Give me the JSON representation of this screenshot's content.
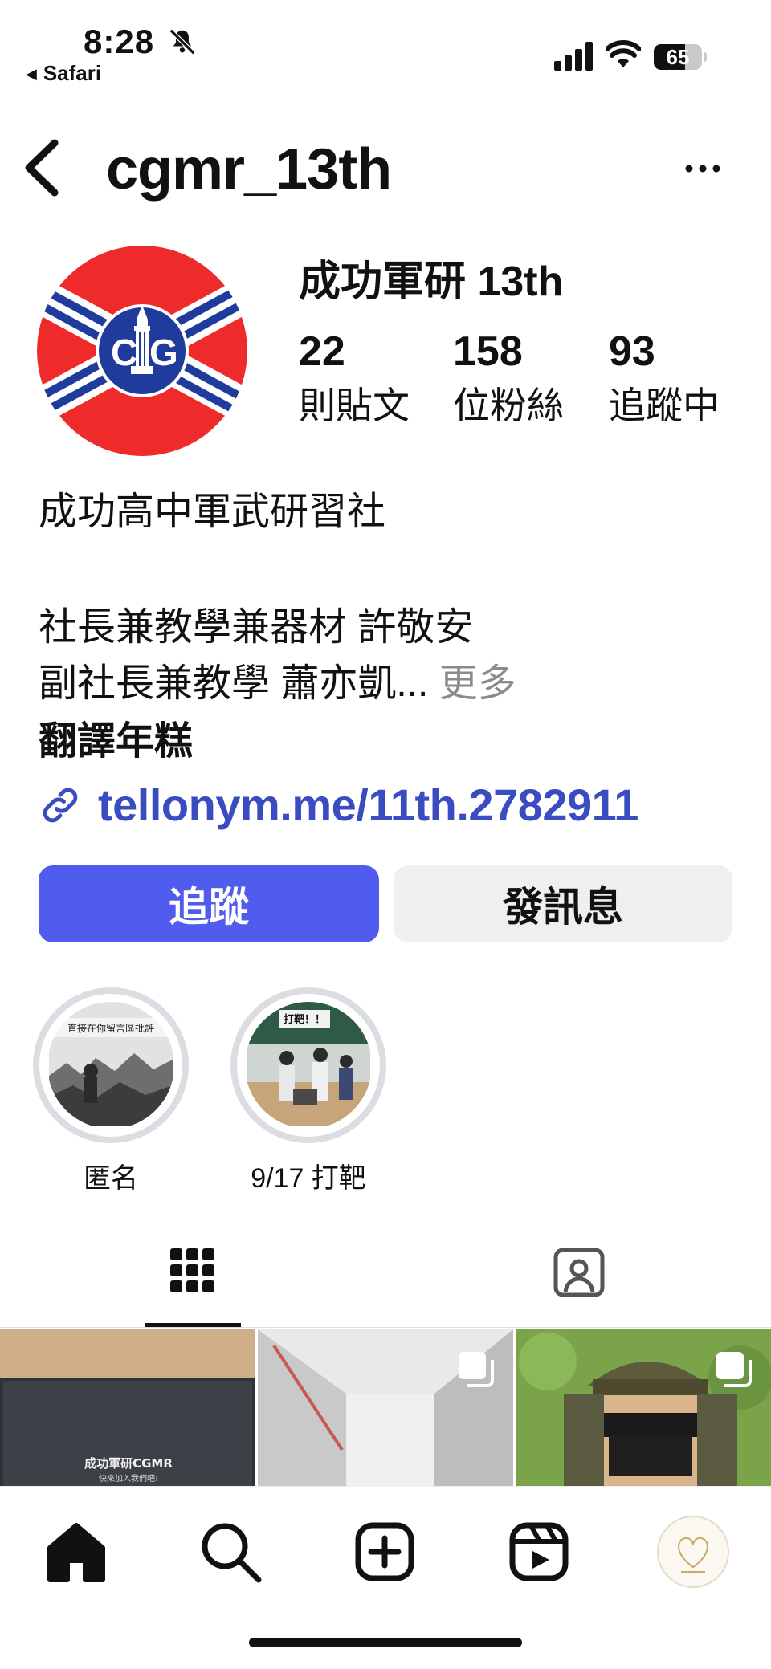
{
  "status_bar": {
    "time": "8:28",
    "back_app": "Safari",
    "battery": "65",
    "battery_level": 0.65
  },
  "header": {
    "username": "cgmr_13th"
  },
  "profile": {
    "avatar_text": "CG",
    "display_name": "成功軍研 13th",
    "stats": [
      {
        "value": "22",
        "label": "則貼文"
      },
      {
        "value": "158",
        "label": "位粉絲"
      },
      {
        "value": "93",
        "label": "追蹤中"
      }
    ],
    "bio": {
      "line1": "成功高中軍武研習社",
      "line2": "社長兼教學兼器材 許敬安",
      "line3": "副社長兼教學 蕭亦凱...",
      "more": " 更多",
      "translate": "翻譯年糕"
    },
    "link": "tellonym.me/11th.2782911"
  },
  "actions": {
    "follow": "追蹤",
    "message": "發訊息"
  },
  "highlights": [
    {
      "label": "匿名",
      "thumb_text": "直接在你留言區批評"
    },
    {
      "label": "9/17 打靶",
      "thumb_text": "打靶！！"
    }
  ],
  "posts": [
    {
      "text": "成功軍研CGMR",
      "subtext": "快來加入我們吧!"
    },
    {
      "text": ""
    },
    {
      "text": ""
    }
  ],
  "colors": {
    "accent": "#4f5ced",
    "link": "#3b4cc0",
    "avatar_red": "#ee2a2a",
    "avatar_blue": "#1f3c9c"
  }
}
